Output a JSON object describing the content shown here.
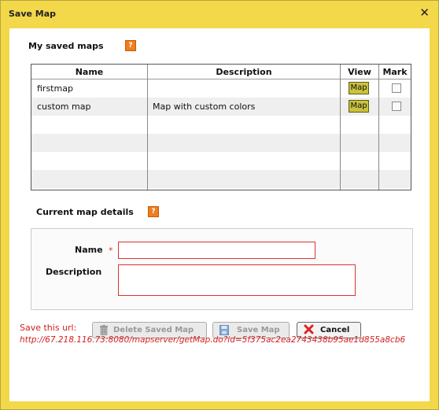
{
  "dialog": {
    "title": "Save Map",
    "close_symbol": "✕"
  },
  "saved_maps": {
    "label": "My saved maps",
    "help_icon": "?",
    "columns": {
      "name": "Name",
      "description": "Description",
      "view": "View",
      "mark": "Mark"
    },
    "rows": [
      {
        "name": "firstmap",
        "description": "",
        "view_label": "Map",
        "marked": false
      },
      {
        "name": "custom map",
        "description": "Map with custom colors",
        "view_label": "Map",
        "marked": false
      }
    ]
  },
  "details": {
    "label": "Current map details",
    "help_icon": "?",
    "name_label": "Name",
    "required_marker": "*",
    "description_label": "Description",
    "name_value": "",
    "description_value": ""
  },
  "buttons": {
    "delete": "Delete Saved Map",
    "save": "Save Map",
    "cancel": "Cancel"
  },
  "url": {
    "label": "Save this url:",
    "value": "http://67.218.116.73:8080/mapserver/getMap.do?id=5f375ac2ea2743438b95ae1d855a8cb6"
  },
  "colors": {
    "frame": "#f3d84a",
    "error_red": "#d32020",
    "map_button": "#c9c23e",
    "help_orange": "#f07e1e"
  }
}
